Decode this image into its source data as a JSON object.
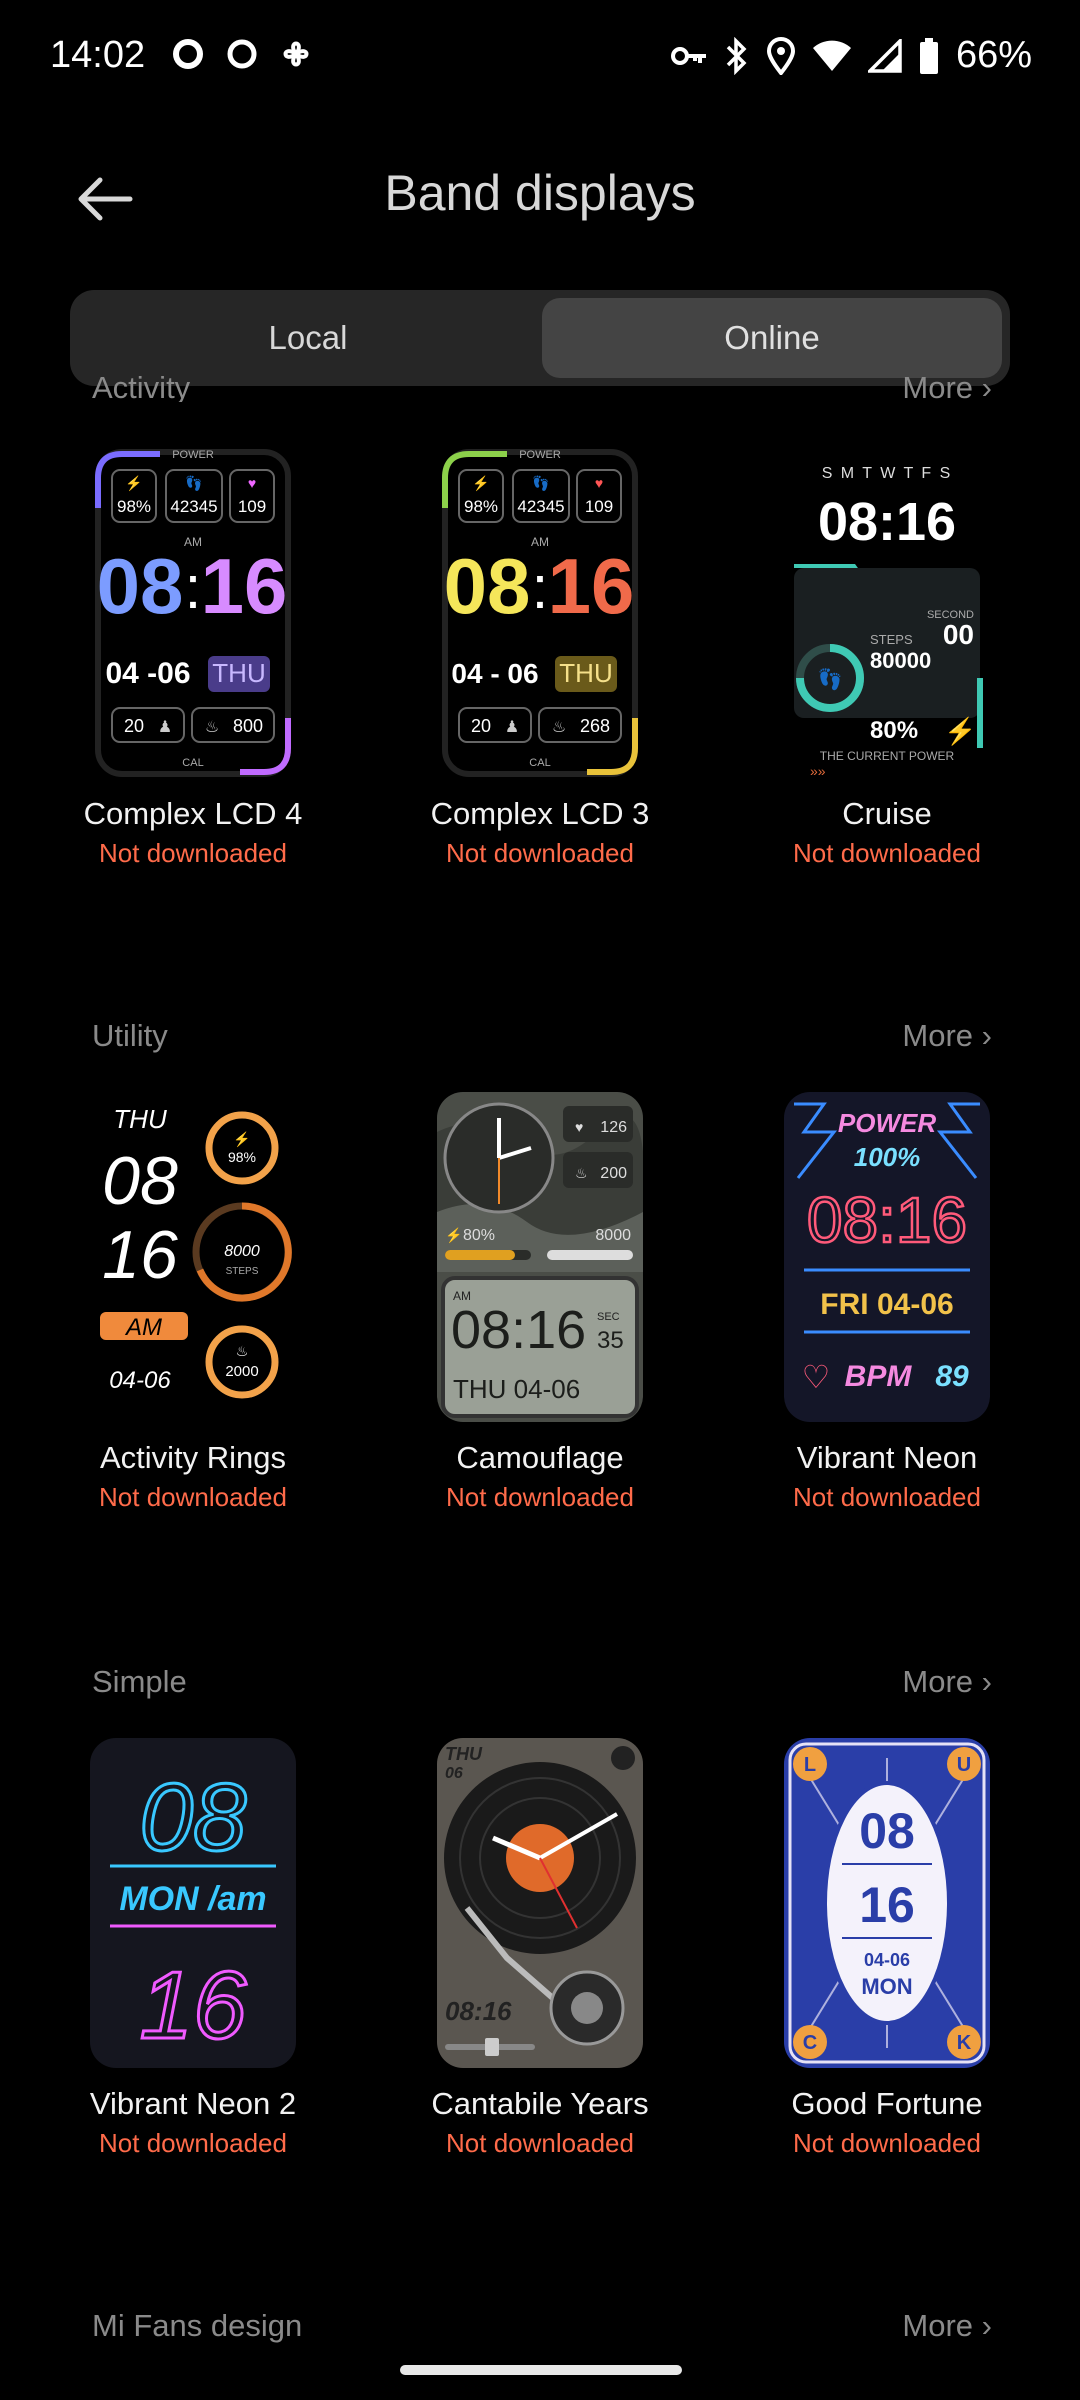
{
  "status_bar": {
    "time": "14:02",
    "battery": "66%"
  },
  "header": {
    "title": "Band displays"
  },
  "tabs": {
    "local": "Local",
    "online": "Online"
  },
  "sections": [
    {
      "name": "Activity",
      "more": "More",
      "items": [
        {
          "name": "Complex LCD 4",
          "status": "Not downloaded"
        },
        {
          "name": "Complex LCD 3",
          "status": "Not downloaded"
        },
        {
          "name": "Cruise",
          "status": "Not downloaded"
        }
      ]
    },
    {
      "name": "Utility",
      "more": "More",
      "items": [
        {
          "name": "Activity Rings",
          "status": "Not downloaded"
        },
        {
          "name": "Camouflage",
          "status": "Not downloaded"
        },
        {
          "name": "Vibrant Neon",
          "status": "Not downloaded"
        }
      ]
    },
    {
      "name": "Simple",
      "more": "More",
      "items": [
        {
          "name": "Vibrant Neon 2",
          "status": "Not downloaded"
        },
        {
          "name": "Cantabile Years",
          "status": "Not downloaded"
        },
        {
          "name": "Good Fortune",
          "status": "Not downloaded"
        }
      ]
    },
    {
      "name": "Mi Fans design",
      "more": "More"
    }
  ],
  "faces": {
    "lcd4": {
      "power": "POWER",
      "battery": "98%",
      "steps": "42345",
      "heart": "109",
      "am": "AM",
      "hour": "08",
      "minute": "16",
      "date": "04 -06",
      "day": "THU",
      "stand": "20",
      "cal": "800",
      "cal_label": "CAL"
    },
    "lcd3": {
      "power": "POWER",
      "battery": "98%",
      "steps": "42345",
      "heart": "109",
      "am": "AM",
      "hour": "08",
      "minute": "16",
      "date": "04 - 06",
      "day": "THU",
      "stand": "20",
      "cal": "268",
      "cal_label": "CAL"
    },
    "cruise": {
      "week": "S M T W T F S",
      "time": "08:16",
      "second_label": "SECOND",
      "second": "00",
      "steps_label": "STEPS",
      "steps": "80000",
      "battery": "80%",
      "caption": "THE CURRENT POWER"
    },
    "rings": {
      "day": "THU",
      "hour": "08",
      "minute": "16",
      "ampm": "AM",
      "date": "04-06",
      "battery": "98%",
      "steps": "8000",
      "steps_label": "STEPS",
      "cal": "2000"
    },
    "camo": {
      "heart": "126",
      "cal": "200",
      "battery": "80%",
      "steps": "8000",
      "am": "AM",
      "time": "08:16",
      "sec_label": "SEC",
      "sec": "35",
      "date": "THU 04-06"
    },
    "neon": {
      "power": "POWER",
      "pct": "100%",
      "time": "08:16",
      "date": "FRI 04-06",
      "bpm": "BPM",
      "bpm_val": "89"
    },
    "neon2": {
      "hour": "08",
      "mid": "MON /am",
      "minute": "16"
    },
    "vinyl": {
      "day": "THU",
      "daynum": "06",
      "time": "08:16"
    },
    "fortune": {
      "c1": "L",
      "c2": "U",
      "c3": "C",
      "c4": "K",
      "hour": "08",
      "minute": "16",
      "date": "04-06",
      "day": "MON"
    }
  }
}
